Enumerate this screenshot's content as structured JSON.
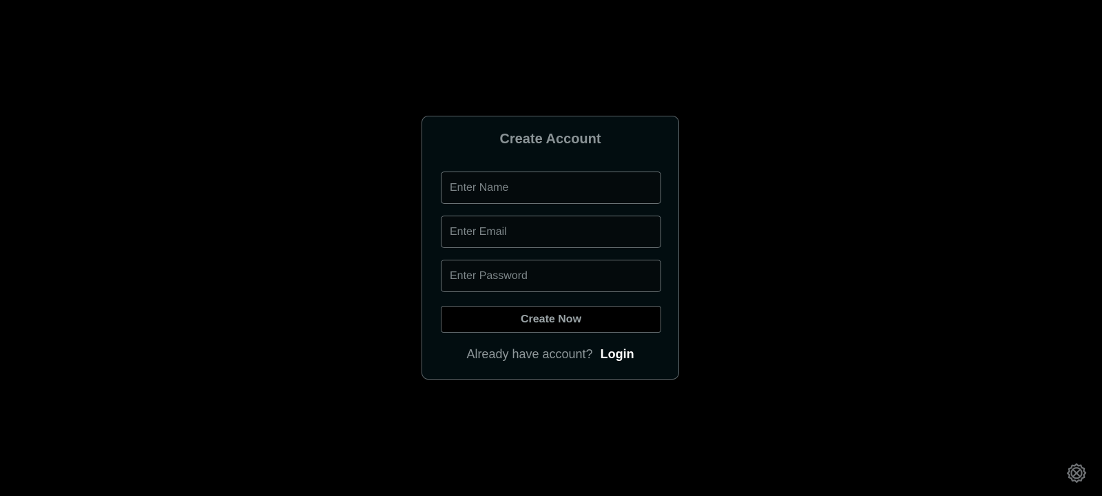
{
  "form": {
    "title": "Create Account",
    "name_placeholder": "Enter Name",
    "email_placeholder": "Enter Email",
    "password_placeholder": "Enter Password",
    "submit_label": "Create Now",
    "switch_prompt": "Already have account?",
    "switch_link": "Login"
  },
  "icons": {
    "corner": "settings-tools-icon"
  },
  "colors": {
    "background": "#000000",
    "card_background": "#020d10",
    "border": "#5b6468",
    "muted_text": "#8a9396",
    "link_text": "#ffffff"
  }
}
